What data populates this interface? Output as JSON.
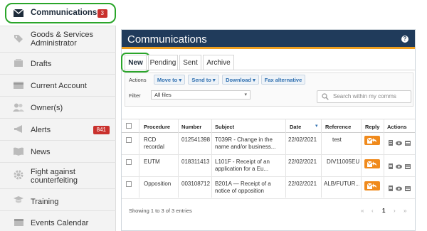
{
  "sidebar": {
    "items": [
      {
        "label": "Communications",
        "icon": "envelope-icon",
        "badge": "3",
        "active": true
      },
      {
        "label": "Goods & Services Administrator",
        "icon": "tag-icon"
      },
      {
        "label": "Drafts",
        "icon": "drafts-icon"
      },
      {
        "label": "Current Account",
        "icon": "account-icon"
      },
      {
        "label": "Owner(s)",
        "icon": "users-icon"
      },
      {
        "label": "Alerts",
        "icon": "megaphone-icon",
        "badge": "841"
      },
      {
        "label": "News",
        "icon": "book-icon"
      },
      {
        "label": "Fight against counterfeiting",
        "icon": "gear-icon"
      },
      {
        "label": "Training",
        "icon": "training-icon"
      },
      {
        "label": "Events Calendar",
        "icon": "calendar-icon"
      }
    ]
  },
  "panel": {
    "title": "Communications",
    "help": "?",
    "tabs": [
      "New",
      "Pending",
      "Sent",
      "Archive"
    ],
    "active_tab": "New",
    "actions_label": "Actions",
    "buttons": [
      "Move to",
      "Send to",
      "Download",
      "Fax alternative"
    ],
    "filter_label": "Filter",
    "filter_value": "All files",
    "search_placeholder": "Search within my comms"
  },
  "table": {
    "headers": [
      "Procedure",
      "Number",
      "Subject",
      "Date",
      "Reference",
      "Reply",
      "Actions"
    ],
    "rows": [
      {
        "procedure": "RCD recordal",
        "number": "012541398",
        "subject": "T039R - Change in the name and/or business...",
        "date": "22/02/2021",
        "reference": "test"
      },
      {
        "procedure": "EUTM",
        "number": "018311413",
        "subject": "L101F - Receipt of an application for a Eu...",
        "date": "22/02/2021",
        "reference": "DIV11005EU"
      },
      {
        "procedure": "Opposition",
        "number": "003108712",
        "subject": "B201A — Receipt of a notice of opposition",
        "date": "22/02/2021",
        "reference": "ALB/FUTUR..."
      }
    ]
  },
  "footer": {
    "summary": "Showing 1 to 3 of 3 entries",
    "pager_first": "«",
    "pager_prev": "‹",
    "pager_current": "1",
    "pager_next": "›",
    "pager_last": "»"
  },
  "colors": {
    "header_bg": "#203b5b",
    "accent_orange": "#f08a1c",
    "highlight_green": "#2aa52a",
    "badge_red": "#c9302c"
  }
}
